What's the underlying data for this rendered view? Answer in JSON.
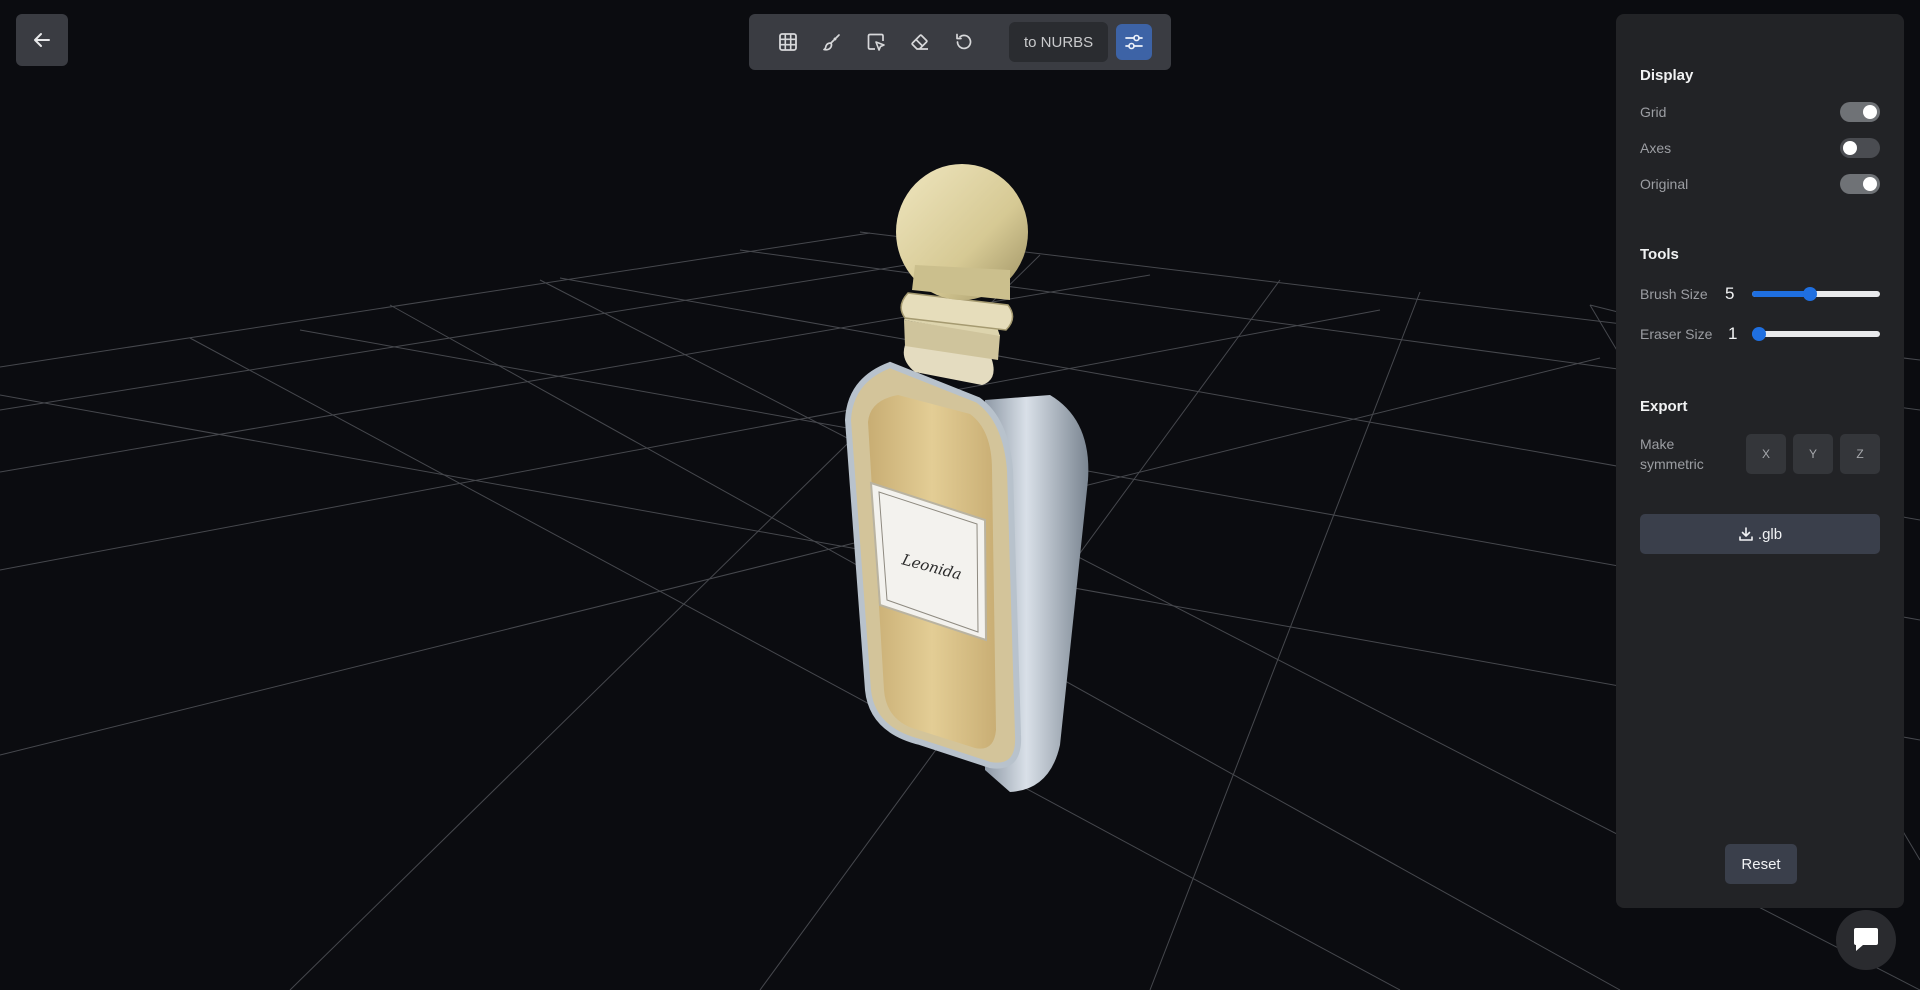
{
  "toolbar": {
    "icons": [
      "grid-icon",
      "brush-icon",
      "select-icon",
      "eraser-icon",
      "undo-icon"
    ],
    "nurbs_label": "to NURBS",
    "settings_icon": "sliders-icon"
  },
  "back_icon": "arrow-left-icon",
  "panel": {
    "display": {
      "title": "Display",
      "grid_label": "Grid",
      "grid_on": true,
      "axes_label": "Axes",
      "axes_on": false,
      "original_label": "Original",
      "original_on": true
    },
    "tools": {
      "title": "Tools",
      "brush_label": "Brush Size",
      "brush_value": "5",
      "brush_fraction": 0.45,
      "eraser_label": "Eraser Size",
      "eraser_value": "1",
      "eraser_fraction": 0.0
    },
    "export": {
      "title": "Export",
      "symmetric_label": "Make symmetric",
      "axis_x": "X",
      "axis_y": "Y",
      "axis_z": "Z",
      "glb_label": ".glb"
    },
    "reset_label": "Reset"
  },
  "model": {
    "label_text": "Leonida"
  },
  "colors": {
    "background": "#0b0c10",
    "panel": "#222326",
    "accent": "#1f6fe0",
    "settings_button": "#3d63a6"
  },
  "chat_icon": "chat-bubble-icon"
}
